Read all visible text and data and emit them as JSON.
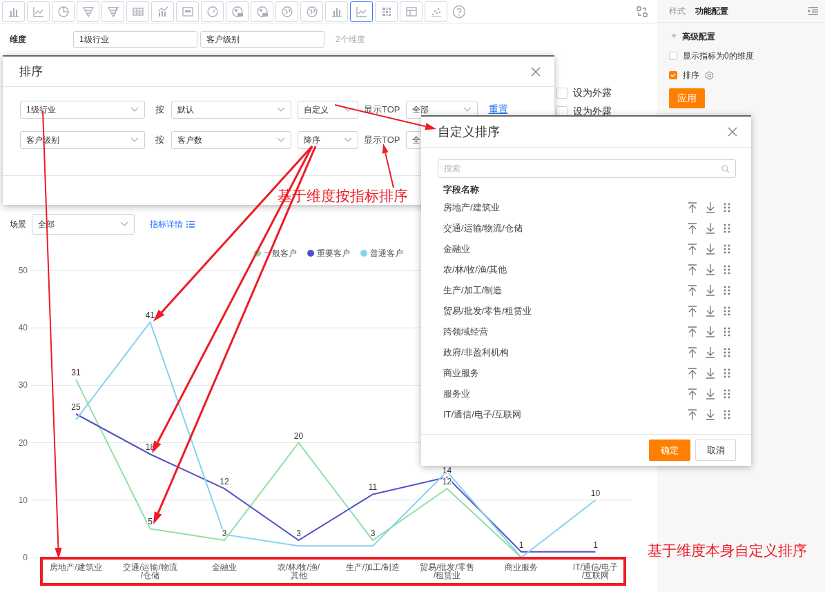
{
  "toolbar": [
    {
      "kind": "bar",
      "selected": false
    },
    {
      "kind": "line",
      "selected": false
    },
    {
      "kind": "pie",
      "selected": false
    },
    {
      "kind": "funnel",
      "selected": false
    },
    {
      "kind": "funnel2",
      "selected": false
    },
    {
      "kind": "table",
      "selected": false
    },
    {
      "kind": "combo",
      "selected": false
    },
    {
      "kind": "card",
      "selected": false
    },
    {
      "kind": "gauge",
      "selected": false
    },
    {
      "kind": "map",
      "selected": false
    },
    {
      "kind": "map",
      "selected": false
    },
    {
      "kind": "globe",
      "selected": false
    },
    {
      "kind": "globe",
      "selected": false
    },
    {
      "kind": "bar",
      "selected": false
    },
    {
      "kind": "line",
      "selected": true
    },
    {
      "kind": "heatmap",
      "selected": false
    },
    {
      "kind": "layout",
      "selected": false
    },
    {
      "kind": "scatter",
      "selected": false
    }
  ],
  "dimension": {
    "label": "维度",
    "fields": [
      "1级行业",
      "客户级别"
    ],
    "count": "2个维度"
  },
  "exposed_options": [
    {
      "label": "设为外露",
      "checked": false
    },
    {
      "label": "设为外露",
      "checked": false
    }
  ],
  "chart_header": {
    "scene_label": "场景",
    "scene_value": "全部",
    "detail_link": "指标详情"
  },
  "chart": {
    "chart_data": {
      "type": "line",
      "categories": [
        "房地产/建筑业",
        "交通/运输/物流/仓储",
        "金融业",
        "农/林/牧/渔/其他",
        "生产/加工/制造",
        "贸易/批发/零售/租赁业",
        "商业服务",
        "IT/通信/电子/互联网"
      ],
      "ylim": [
        0,
        50
      ],
      "yticks": [
        0,
        10,
        20,
        30,
        40,
        50
      ],
      "grid": true,
      "legend": "top",
      "series": [
        {
          "name": "一般客户",
          "color": "#8fe0a3",
          "values": [
            31,
            5,
            3,
            20,
            3,
            12,
            0,
            null
          ]
        },
        {
          "name": "重要客户",
          "color": "#5152c8",
          "values": [
            25,
            18,
            12,
            3,
            11,
            14,
            1,
            1
          ]
        },
        {
          "name": "普通客户",
          "color": "#86d3ef",
          "values": [
            24,
            41,
            4,
            2,
            2,
            15,
            0,
            10
          ]
        }
      ],
      "value_labels": [
        [
          "31",
          "5",
          "3",
          "20",
          "3",
          "12",
          null,
          null
        ],
        [
          "25",
          "18",
          "12",
          "3",
          "11",
          "14",
          "1",
          "1"
        ],
        [
          null,
          "41",
          null,
          null,
          null,
          null,
          null,
          "10"
        ]
      ]
    }
  },
  "sort_dialog": {
    "title": "排序",
    "rows": [
      {
        "field": "1级行业",
        "by_label": "按",
        "by": "默认",
        "order": "自定义",
        "top_label": "显示TOP",
        "top": "全部",
        "reset": "重置"
      },
      {
        "field": "客户级别",
        "by_label": "按",
        "by": "客户数",
        "order": "降序",
        "top_label": "显示TOP",
        "top": "全"
      }
    ]
  },
  "custom_sort_dialog": {
    "title": "自定义排序",
    "search_placeholder": "搜索",
    "column_header": "字段名称",
    "items": [
      "房地产/建筑业",
      "交通/运输/物流/仓储",
      "金融业",
      "农/林/牧/渔/其他",
      "生产/加工/制造",
      "贸易/批发/零售/租赁业",
      "跨领域经营",
      "政府/非盈利机构",
      "商业服务",
      "服务业",
      "IT/通信/电子/互联网"
    ],
    "confirm": "确定",
    "cancel": "取消"
  },
  "side_panel": {
    "tabs": [
      {
        "label": "样式",
        "selected": false
      },
      {
        "label": "功能配置",
        "selected": true
      }
    ],
    "section": {
      "title": "高级配置",
      "expanded": true
    },
    "options": [
      {
        "label": "显示指标为0的维度",
        "checked": false,
        "has_settings": false
      },
      {
        "label": "排序",
        "checked": true,
        "has_settings": true
      }
    ],
    "apply": "应用"
  },
  "annotations": [
    "基于维度按指标排序",
    "基于维度本身自定义排序"
  ]
}
